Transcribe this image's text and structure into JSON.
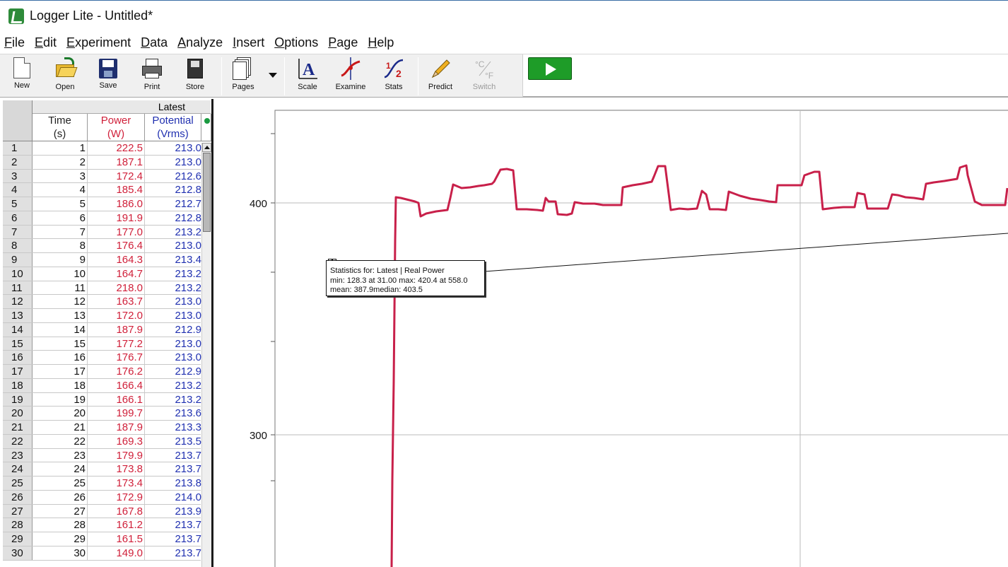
{
  "window": {
    "title": "Logger Lite - Untitled*"
  },
  "menu": [
    "File",
    "Edit",
    "Experiment",
    "Data",
    "Analyze",
    "Insert",
    "Options",
    "Page",
    "Help"
  ],
  "toolbar": {
    "new": "New",
    "open": "Open",
    "save": "Save",
    "print": "Print",
    "store": "Store",
    "pages": "Pages",
    "scale": "Scale",
    "examine": "Examine",
    "stats": "Stats",
    "predict": "Predict",
    "switch": "Switch"
  },
  "table": {
    "group_label": "Latest",
    "columns": [
      {
        "name": "Time",
        "unit": "(s)"
      },
      {
        "name": "Power",
        "unit": "(W)"
      },
      {
        "name": "Potential",
        "unit": "(Vrms)"
      }
    ],
    "rows": [
      [
        "1",
        "1",
        "222.5",
        "213.0"
      ],
      [
        "2",
        "2",
        "187.1",
        "213.0"
      ],
      [
        "3",
        "3",
        "172.4",
        "212.6"
      ],
      [
        "4",
        "4",
        "185.4",
        "212.8"
      ],
      [
        "5",
        "5",
        "186.0",
        "212.7"
      ],
      [
        "6",
        "6",
        "191.9",
        "212.8"
      ],
      [
        "7",
        "7",
        "177.0",
        "213.2"
      ],
      [
        "8",
        "8",
        "176.4",
        "213.0"
      ],
      [
        "9",
        "9",
        "164.3",
        "213.4"
      ],
      [
        "10",
        "10",
        "164.7",
        "213.2"
      ],
      [
        "11",
        "11",
        "218.0",
        "213.2"
      ],
      [
        "12",
        "12",
        "163.7",
        "213.0"
      ],
      [
        "13",
        "13",
        "172.0",
        "213.0"
      ],
      [
        "14",
        "14",
        "187.9",
        "212.9"
      ],
      [
        "15",
        "15",
        "177.2",
        "213.0"
      ],
      [
        "16",
        "16",
        "176.7",
        "213.0"
      ],
      [
        "17",
        "17",
        "176.2",
        "212.9"
      ],
      [
        "18",
        "18",
        "166.4",
        "213.2"
      ],
      [
        "19",
        "19",
        "166.1",
        "213.2"
      ],
      [
        "20",
        "20",
        "199.7",
        "213.6"
      ],
      [
        "21",
        "21",
        "187.9",
        "213.3"
      ],
      [
        "22",
        "22",
        "169.3",
        "213.5"
      ],
      [
        "23",
        "23",
        "179.9",
        "213.7"
      ],
      [
        "24",
        "24",
        "173.8",
        "213.7"
      ],
      [
        "25",
        "25",
        "173.4",
        "213.8"
      ],
      [
        "26",
        "26",
        "172.9",
        "214.0"
      ],
      [
        "27",
        "27",
        "167.8",
        "213.9"
      ],
      [
        "28",
        "28",
        "161.2",
        "213.7"
      ],
      [
        "29",
        "29",
        "161.5",
        "213.7"
      ],
      [
        "30",
        "30",
        "149.0",
        "213.7"
      ]
    ]
  },
  "graph": {
    "y_ticks": [
      "400",
      "300"
    ],
    "line_color": "#c8204a",
    "stats_box": {
      "line1": "Statistics for: Latest | Real Power",
      "line2": "min: 128.3 at 31.00 max: 420.4 at 558.0",
      "line3": "mean: 387.9median: 403.5"
    }
  }
}
